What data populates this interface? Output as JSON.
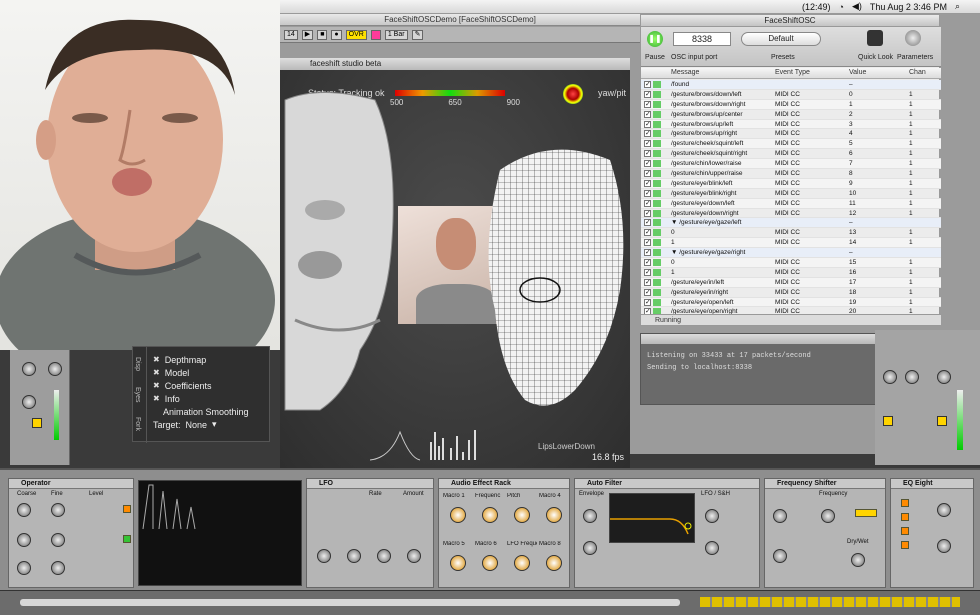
{
  "menubar": {
    "battery": "(12:49)",
    "datetime": "Thu Aug 2  3:46 PM"
  },
  "ableton": {
    "title": "FaceShiftOSCDemo  [FaceShiftOSCDemo]",
    "toolbar": {
      "bar": "1 Bar",
      "ovr": "OVR",
      "meter": "14"
    }
  },
  "faceshift": {
    "title": "faceshift studio beta",
    "status": "Status: Tracking ok",
    "scale_ticks": [
      "500",
      "650",
      "900"
    ],
    "yaw_label": "yaw/pit",
    "fps": "16.8 fps",
    "blendshape_label": "LipsLowerDown",
    "panel": {
      "tab_labels": [
        "Disp",
        "Eyes",
        "Fork"
      ],
      "options": [
        {
          "label": "Depthmap"
        },
        {
          "label": "Model"
        },
        {
          "label": "Coefficients"
        },
        {
          "label": "Info"
        }
      ],
      "smoothing_label": "Animation Smoothing",
      "target_label": "Target:",
      "target_value": "None"
    }
  },
  "osc": {
    "title": "FaceShiftOSC",
    "pause_label": "Pause",
    "port_value": "8338",
    "port_label": "OSC input port",
    "preset_value": "Default",
    "presets_label": "Presets",
    "quicklook_label": "Quick Look",
    "parameters_label": "Parameters",
    "columns": [
      "Message",
      "Event Type",
      "Value",
      "Chan"
    ],
    "rows": [
      {
        "msg": "/found",
        "type": "",
        "value": "–",
        "chan": "",
        "group": true
      },
      {
        "msg": "/gesture/brows/down/left",
        "type": "MIDI CC",
        "value": "0",
        "chan": "1"
      },
      {
        "msg": "/gesture/brows/down/right",
        "type": "MIDI CC",
        "value": "1",
        "chan": "1"
      },
      {
        "msg": "/gesture/brows/up/center",
        "type": "MIDI CC",
        "value": "2",
        "chan": "1"
      },
      {
        "msg": "/gesture/brows/up/left",
        "type": "MIDI CC",
        "value": "3",
        "chan": "1"
      },
      {
        "msg": "/gesture/brows/up/right",
        "type": "MIDI CC",
        "value": "4",
        "chan": "1"
      },
      {
        "msg": "/gesture/cheek/squint/left",
        "type": "MIDI CC",
        "value": "5",
        "chan": "1"
      },
      {
        "msg": "/gesture/cheek/squint/right",
        "type": "MIDI CC",
        "value": "6",
        "chan": "1"
      },
      {
        "msg": "/gesture/chin/lower/raise",
        "type": "MIDI CC",
        "value": "7",
        "chan": "1"
      },
      {
        "msg": "/gesture/chin/upper/raise",
        "type": "MIDI CC",
        "value": "8",
        "chan": "1"
      },
      {
        "msg": "/gesture/eye/blink/left",
        "type": "MIDI CC",
        "value": "9",
        "chan": "1"
      },
      {
        "msg": "/gesture/eye/blink/right",
        "type": "MIDI CC",
        "value": "10",
        "chan": "1"
      },
      {
        "msg": "/gesture/eye/down/left",
        "type": "MIDI CC",
        "value": "11",
        "chan": "1"
      },
      {
        "msg": "/gesture/eye/down/right",
        "type": "MIDI CC",
        "value": "12",
        "chan": "1"
      },
      {
        "msg": "▼ /gesture/eye/gaze/left",
        "type": "",
        "value": "–",
        "chan": "",
        "group": true
      },
      {
        "msg": "    0",
        "type": "MIDI CC",
        "value": "13",
        "chan": "1"
      },
      {
        "msg": "    1",
        "type": "MIDI CC",
        "value": "14",
        "chan": "1"
      },
      {
        "msg": "▼ /gesture/eye/gaze/right",
        "type": "",
        "value": "–",
        "chan": "",
        "group": true
      },
      {
        "msg": "    0",
        "type": "MIDI CC",
        "value": "15",
        "chan": "1"
      },
      {
        "msg": "    1",
        "type": "MIDI CC",
        "value": "16",
        "chan": "1"
      },
      {
        "msg": "/gesture/eye/in/left",
        "type": "MIDI CC",
        "value": "17",
        "chan": "1"
      },
      {
        "msg": "/gesture/eye/in/right",
        "type": "MIDI CC",
        "value": "18",
        "chan": "1"
      },
      {
        "msg": "/gesture/eye/open/left",
        "type": "MIDI CC",
        "value": "19",
        "chan": "1"
      },
      {
        "msg": "/gesture/eye/open/right",
        "type": "MIDI CC",
        "value": "20",
        "chan": "1"
      }
    ],
    "status": "Running"
  },
  "log": {
    "line1": "Listening on 33433 at 17 packets/second",
    "line2": "Sending to localhost:8338"
  },
  "devices": {
    "operator": "Operator",
    "audio_effect_rack": "Audio Effect Rack",
    "auto_filter": "Auto Filter",
    "frequency_shifter": "Frequency Shifter",
    "eq_eight": "EQ Eight",
    "rack_macros": [
      "Macro 1",
      "Frequenc",
      "Pitch",
      "Macro 4",
      "Macro 5",
      "Macro 6",
      "LFO Frequenc",
      "Macro 8"
    ],
    "op_labels": [
      "Coarse",
      "Fine",
      "Level"
    ],
    "lfo_label": "LFO",
    "rate_label": "Rate",
    "amount_label": "Amount",
    "envelope_label": "Envelope",
    "lfo_sh_label": "LFO / S&H",
    "frequency_label": "Frequency",
    "drywet_label": "Dry/Wet"
  },
  "colors": {
    "accent_orange": "#ff8a00",
    "status_green": "#33aa33",
    "ableton_gray": "#b5b5b5"
  }
}
